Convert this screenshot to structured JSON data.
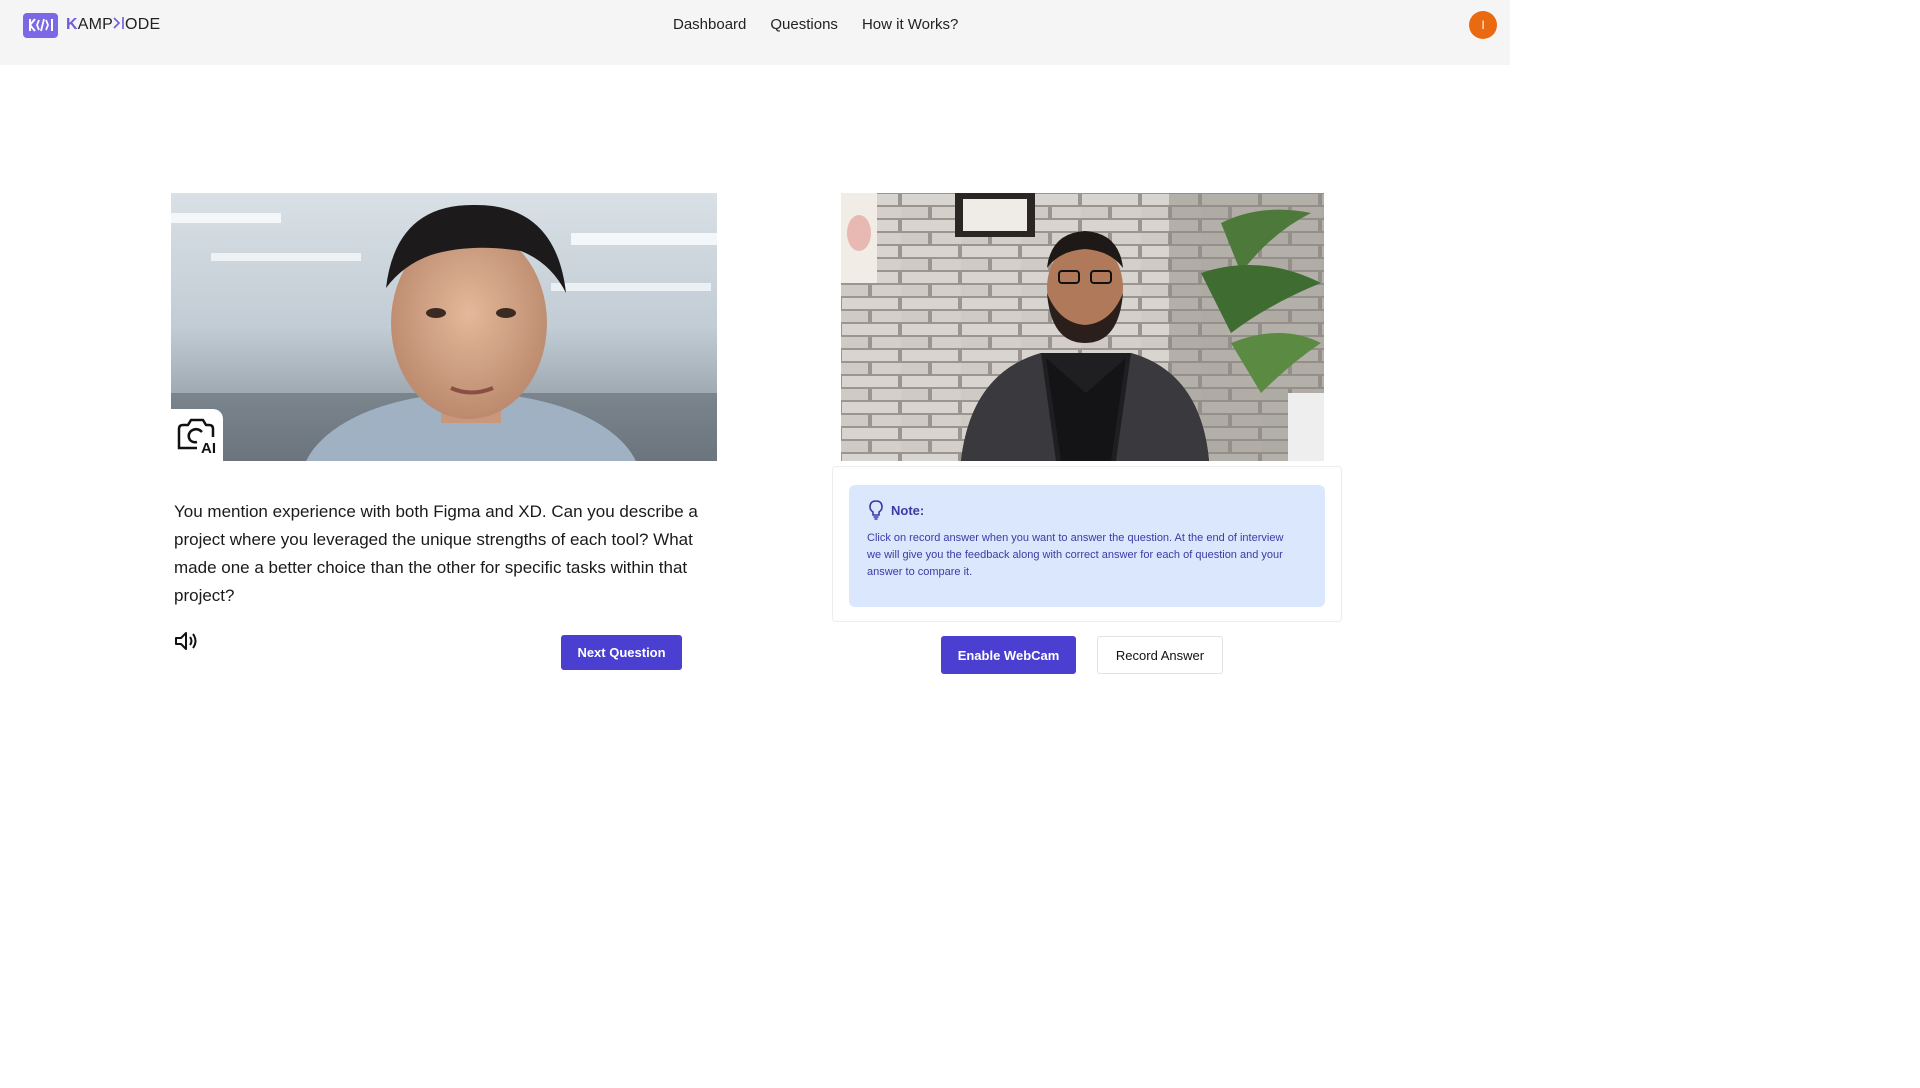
{
  "header": {
    "logo_glyph": "K</>",
    "logo_prefix": "K",
    "logo_middle": "AMP",
    "logo_mid_glyph": "></",
    "logo_suffix": "ODE",
    "nav": [
      "Dashboard",
      "Questions",
      "How it Works?"
    ],
    "avatar_initial": "I"
  },
  "interviewer": {
    "badge_text": "AI",
    "question": "You mention experience with both Figma and XD. Can you describe a project where you leveraged the unique strengths of each tool? What made one a better choice than the other for specific tasks within that project?",
    "next_label": "Next Question"
  },
  "webcam": {
    "note_title": "Note:",
    "note_body": "Click on record answer when you want to answer the question. At the end of interview we will give you the feedback along with correct answer for each of question and your answer to compare it.",
    "enable_label": "Enable WebCam",
    "record_label": "Record Answer"
  },
  "colors": {
    "primary": "#4a3fd0",
    "avatar": "#ea6a12",
    "note_bg": "#dbe7fd",
    "note_text": "#3d3aa6",
    "logo": "#7b68e6"
  }
}
